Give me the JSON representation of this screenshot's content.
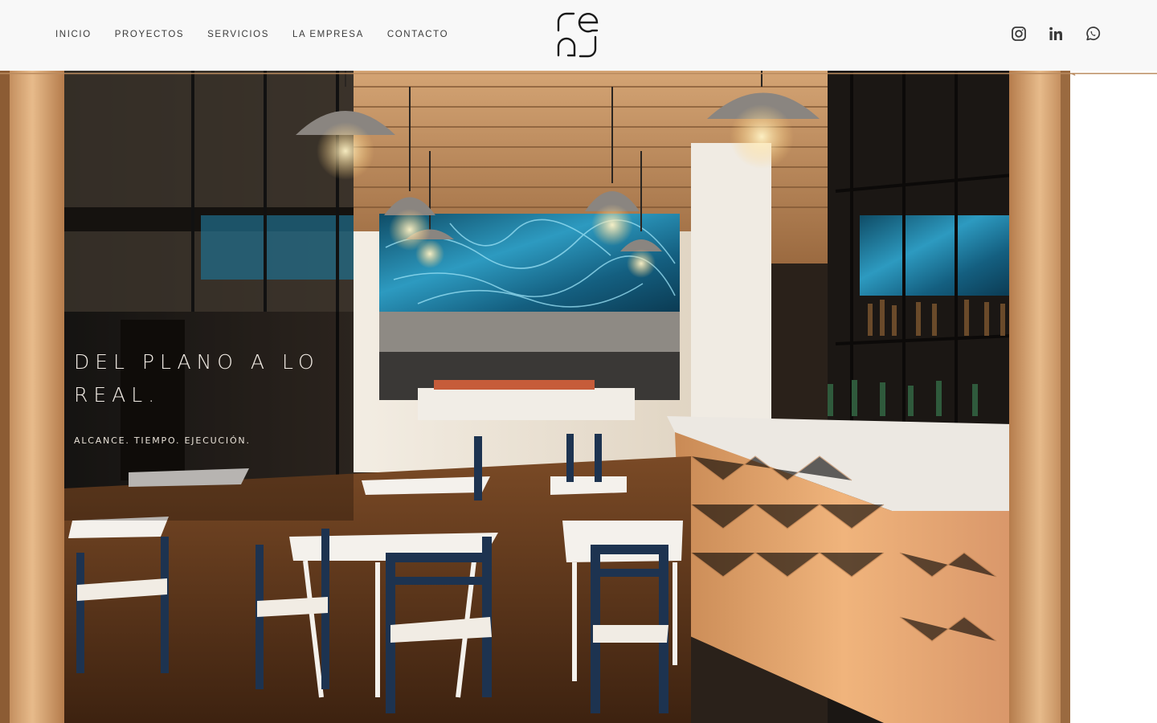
{
  "header": {
    "nav": [
      {
        "label": "INICIO"
      },
      {
        "label": "PROYECTOS"
      },
      {
        "label": "SERVICIOS"
      },
      {
        "label": "LA EMPRESA"
      },
      {
        "label": "CONTACTO"
      }
    ],
    "logo": {
      "text": "ce aj"
    },
    "social": [
      {
        "icon": "instagram-icon"
      },
      {
        "icon": "linkedin-icon"
      },
      {
        "icon": "whatsapp-icon"
      }
    ],
    "accent_line_color": "#b98a5e"
  },
  "hero": {
    "title": "DEL PLANO A LO REAL.",
    "subtitle": "ALCANCE. TIEMPO. EJECUCIÓN."
  },
  "colors": {
    "header_bg": "#f8f8f8",
    "nav_text": "#3a3a3a",
    "accent": "#b98a5e",
    "wood": "#c99566",
    "tile_blue": "#2a86a8",
    "chair_navy": "#1d3350"
  }
}
